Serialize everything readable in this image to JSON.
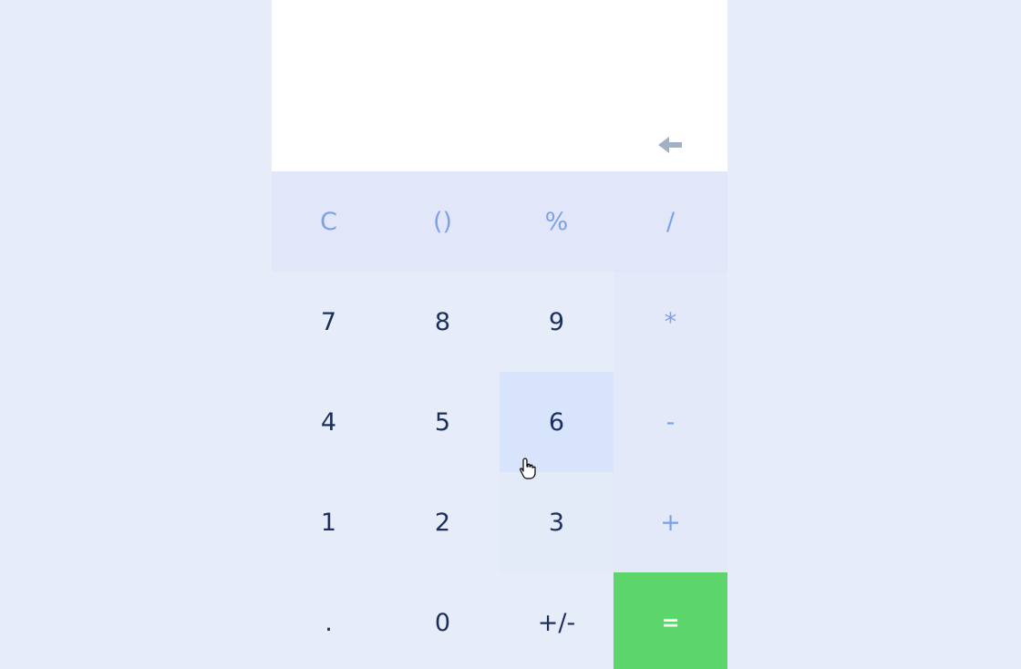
{
  "display": {
    "value": "",
    "backspace_icon": "left-arrow-icon"
  },
  "keys": {
    "clear": "C",
    "parens": "()",
    "percent": "%",
    "divide": "/",
    "seven": "7",
    "eight": "8",
    "nine": "9",
    "multiply": "*",
    "four": "4",
    "five": "5",
    "six": "6",
    "subtract": "-",
    "one": "1",
    "two": "2",
    "three": "3",
    "add": "+",
    "decimal": ".",
    "zero": "0",
    "negate": "+/-",
    "equals": "="
  },
  "colors": {
    "page_background": "#e6edf9",
    "display_background": "#ffffff",
    "digit_text": "#1c2e5c",
    "operator_text": "#7ea1e6",
    "equals_background": "#5cd56a",
    "equals_text": "#ffffff",
    "active_key_background": "#d7e4fb"
  }
}
